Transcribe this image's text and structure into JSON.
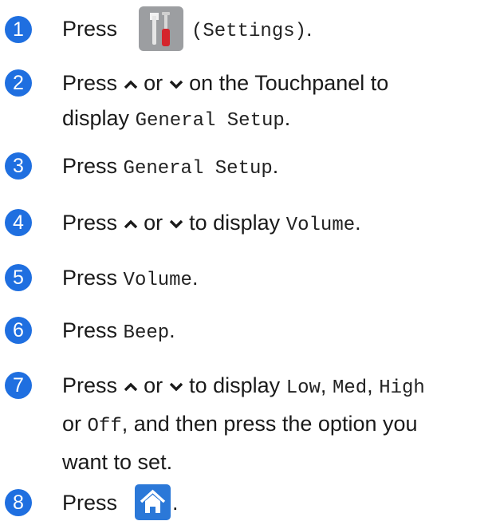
{
  "steps": [
    {
      "number": "1",
      "word": "Press",
      "mono": "(Settings)",
      "tail": "."
    },
    {
      "number": "2",
      "word": "Press",
      "or": "or",
      "line1_tail": "on the Touchpanel to",
      "line2_pre": "display",
      "mono": "General Setup",
      "tail": "."
    },
    {
      "number": "3",
      "word": "Press",
      "mono": "General Setup",
      "tail": "."
    },
    {
      "number": "4",
      "word": "Press",
      "or": "or",
      "mid": "to display",
      "mono": "Volume",
      "tail": "."
    },
    {
      "number": "5",
      "word": "Press",
      "mono": "Volume",
      "tail": "."
    },
    {
      "number": "6",
      "word": "Press",
      "mono": "Beep",
      "tail": "."
    },
    {
      "number": "7",
      "word": "Press",
      "or": "or",
      "mid": "to display",
      "opt1": "Low",
      "sep1": ",",
      "opt2": "Med",
      "sep2": ",",
      "opt3": "High",
      "line2_pre": "or",
      "opt4": "Off",
      "line2_tail": ", and then press the option you",
      "line3": "want to set."
    },
    {
      "number": "8",
      "word": "Press",
      "tail": "."
    }
  ],
  "icons": {
    "settings": "settings-icon",
    "home": "home-icon",
    "up": "chevron-up-icon",
    "down": "chevron-down-icon"
  },
  "colors": {
    "step_circle": "#1f6fe0",
    "home_icon": "#2b78d8",
    "settings_icon": "#9c9ea1"
  }
}
